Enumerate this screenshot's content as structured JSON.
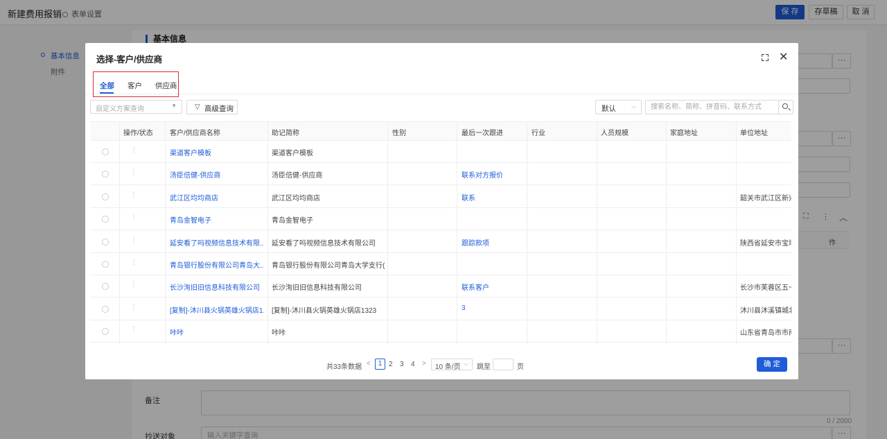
{
  "page": {
    "title": "新建费用报销",
    "form_settings": "表单设置",
    "buttons": {
      "save": "保 存",
      "draft": "存草稿",
      "cancel": "取 消"
    },
    "nav": [
      "基本信息",
      "附件"
    ],
    "section": "基本信息",
    "remark_label": "备注",
    "cc_label": "抄送对象",
    "cc_placeholder": "输入关键字查询",
    "remark_counter": "0 / 2000",
    "table_fragment": "作",
    "dots": "···"
  },
  "modal": {
    "title": "选择-客户/供应商",
    "tabs": [
      "全部",
      "客户",
      "供应商"
    ],
    "active_tab": 0,
    "scheme_placeholder": "自定义方案查询",
    "advanced_query": "高级查询",
    "sort_value": "默认",
    "search_placeholder": "搜索名称、简称、拼音码、联系方式",
    "columns": [
      "操作/状态",
      "客户/供应商名称",
      "助记简称",
      "性别",
      "最后一次跟进",
      "行业",
      "人员规模",
      "家庭地址",
      "单位地址"
    ],
    "rows": [
      {
        "name": "渠道客户模板",
        "short": "渠道客户模板",
        "follow": "",
        "address": ""
      },
      {
        "name": "汤臣倍健-供应商",
        "short": "汤臣倍健-供应商",
        "follow": "联系对方报价",
        "address": ""
      },
      {
        "name": "武江区均均商店",
        "short": "武江区均均商店",
        "follow": "联系",
        "address": "韶关市武江区新兴"
      },
      {
        "name": "青岛金智电子",
        "short": "青岛金智电子",
        "follow": "",
        "address": ""
      },
      {
        "name": "延安看了吗视频信息技术有限...",
        "short": "延安看了吗视频信息技术有限公司",
        "follow": "跟踪款项",
        "address": "陕西省延安市宝塔"
      },
      {
        "name": "青岛银行股份有限公司青岛大...",
        "short": "青岛银行股份有限公司青岛大学支行(...",
        "follow": "",
        "address": ""
      },
      {
        "name": "长沙洵旧旧信息科技有限公司",
        "short": "长沙洵旧旧信息科技有限公司",
        "follow": "联系客户",
        "address": "长沙市芙蓉区五一"
      },
      {
        "name": "[复制]-沐川县火锅英雄火锅店1...",
        "short": "[复制]-沐川县火锅英雄火锅店1323",
        "follow": "3",
        "address": "沐川县沐溪镇城北"
      },
      {
        "name": "咔咔",
        "short": "咔咔",
        "follow": "",
        "address": "山东省青岛市市南"
      }
    ],
    "pagination": {
      "total": "共33条数据",
      "pages": [
        "1",
        "2",
        "3",
        "4"
      ],
      "current": "1",
      "page_size": "10 条/页",
      "jump_label": "跳至",
      "page_label": "页"
    },
    "confirm": "确 定"
  }
}
